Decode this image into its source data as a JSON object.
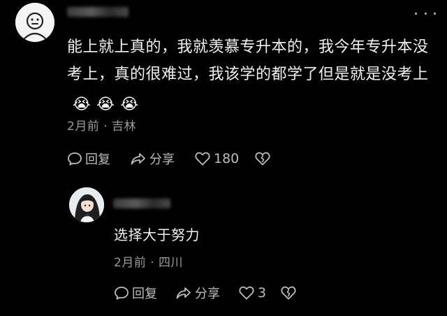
{
  "main_comment": {
    "text": "能上就上真的，我就羡慕专升本的，我今年专升本没考上，真的很难过，我该学的都学了但是就是没考上",
    "emojis": [
      "😭",
      "😭",
      "😭"
    ],
    "time": "2月前",
    "separator": "·",
    "location": "吉林",
    "reply_label": "回复",
    "share_label": "分享",
    "like_count": "180"
  },
  "reply_comment": {
    "text": "选择大于努力",
    "time": "2月前",
    "separator": "·",
    "location": "四川",
    "reply_label": "回复",
    "share_label": "分享",
    "like_count": "3"
  },
  "colors": {
    "background": "#000000",
    "text": "#f2f2f2",
    "meta": "#9a9a9a",
    "action": "#bdbdbd"
  },
  "icons": {
    "reply": "comment-bubble-icon",
    "share": "share-arrow-icon",
    "like": "heart-icon",
    "dislike": "broken-heart-icon",
    "more": "more-dots-icon"
  }
}
